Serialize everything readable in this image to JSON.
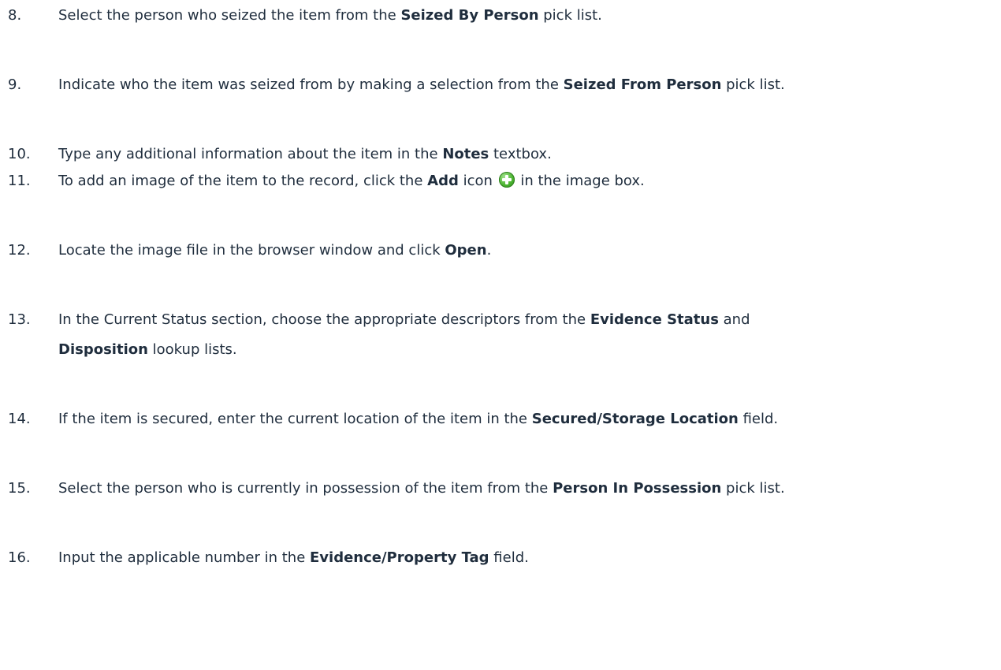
{
  "steps": [
    {
      "number": "8.",
      "pre": "Select the person who seized the item from the ",
      "b1": "Seized By Person",
      "post": " pick list."
    },
    {
      "number": "9.",
      "pre": "Indicate who the item was seized from by making a selection from the ",
      "b1": "Seized From Person",
      "post": " pick list."
    },
    {
      "number": "10.",
      "pre": "Type any additional information about the item in the ",
      "b1": "Notes",
      "post": " textbox."
    },
    {
      "number": "11.",
      "pre": "To add an image of the item to the record, click the ",
      "b1": "Add",
      "mid": " icon ",
      "post": " in the image box.",
      "icon": "add-plus-icon"
    },
    {
      "number": "12.",
      "pre": "Locate the image file in the browser window and click ",
      "b1": "Open",
      "post": "."
    },
    {
      "number": "13.",
      "pre": "In the Current Status section, choose the appropriate descriptors from the ",
      "b1": "Evidence Status",
      "post": " and",
      "line2_b": "Disposition",
      "line2_post": " lookup lists."
    },
    {
      "number": "14.",
      "pre": "If the item is secured, enter the current location of the item in the ",
      "b1": "Secured/Storage Location",
      "post": " field."
    },
    {
      "number": "15.",
      "pre": "Select the person who is currently in possession of the item from the ",
      "b1": "Person In Possession",
      "post": " pick list."
    },
    {
      "number": "16.",
      "pre": "Input the applicable number in the ",
      "b1": "Evidence/Property Tag",
      "post": " field."
    }
  ]
}
